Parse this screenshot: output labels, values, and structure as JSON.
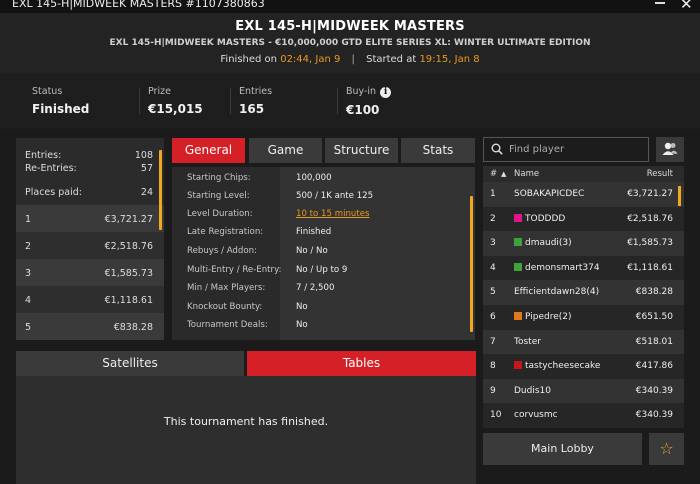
{
  "window": {
    "title": "EXL 145-H|MIDWEEK MASTERS #1107380863",
    "close_glyph": "✕"
  },
  "header": {
    "title": "EXL 145-H|MIDWEEK MASTERS",
    "subtitle": "EXL 145-H|MIDWEEK MASTERS - €10,000,000 GTD ELITE SERIES XL: WINTER ULTIMATE EDITION",
    "finished_label": "Finished on",
    "finished_time": "02:44, Jan 9",
    "separator": "|",
    "started_label": "Started at",
    "started_time": "19:15, Jan 8"
  },
  "summary": {
    "status_label": "Status",
    "status_value": "Finished",
    "prize_label": "Prize",
    "prize_value": "€15,015",
    "entries_label": "Entries",
    "entries_value": "165",
    "buyin_label": "Buy-in",
    "buyin_value": "€100",
    "info_icon": "info-icon"
  },
  "entries_box": {
    "entries_label": "Entries:",
    "entries_value": "108",
    "reentries_label": "Re-Entries:",
    "reentries_value": "57",
    "places_label": "Places paid:",
    "places_value": "24"
  },
  "payouts": [
    {
      "place": "1",
      "amount": "€3,721.27"
    },
    {
      "place": "2",
      "amount": "€2,518.76"
    },
    {
      "place": "3",
      "amount": "€1,585.73"
    },
    {
      "place": "4",
      "amount": "€1,118.61"
    },
    {
      "place": "5",
      "amount": "€838.28"
    }
  ],
  "tabs": {
    "general": "General",
    "game": "Game",
    "structure": "Structure",
    "stats": "Stats",
    "active": "general"
  },
  "details": [
    {
      "key": "Starting Chips:",
      "value": "100,000"
    },
    {
      "key": "Starting Level:",
      "value": "500 / 1K ante 125"
    },
    {
      "key": "Level Duration:",
      "value": "10 to 15 minutes"
    },
    {
      "key": "Late Registration:",
      "value": "Finished"
    },
    {
      "key": "Rebuys / Addon:",
      "value": "No / No"
    },
    {
      "key": "Multi-Entry / Re-Entry:",
      "value": "No / Up to 9"
    },
    {
      "key": "Min / Max Players:",
      "value": "7 / 2,500"
    },
    {
      "key": "Knockout Bounty:",
      "value": "No"
    },
    {
      "key": "Tournament Deals:",
      "value": "No"
    }
  ],
  "bottom_tabs": {
    "satellites": "Satellites",
    "tables": "Tables",
    "active": "tables"
  },
  "tables_message": "This tournament has finished.",
  "search": {
    "placeholder": "Find player"
  },
  "player_list": {
    "col_rank": "#",
    "col_sort": "▲",
    "col_name": "Name",
    "col_result": "Result",
    "rows": [
      {
        "rank": "1",
        "name": "SOBAKAPICDEC",
        "flag": "",
        "result": "€3,721.27"
      },
      {
        "rank": "2",
        "name": "TODDDD",
        "flag": "#e0158a",
        "result": "€2,518.76"
      },
      {
        "rank": "3",
        "name": "dmaudi(3)",
        "flag": "#3fa33a",
        "result": "€1,585.73"
      },
      {
        "rank": "4",
        "name": "demonsmart374",
        "flag": "#3fa33a",
        "result": "€1,118.61"
      },
      {
        "rank": "5",
        "name": "Efficientdawn28(4)",
        "flag": "",
        "result": "€838.28"
      },
      {
        "rank": "6",
        "name": "Pipedre(2)",
        "flag": "#e07a1e",
        "result": "€651.50"
      },
      {
        "rank": "7",
        "name": "Toster",
        "flag": "",
        "result": "€518.01"
      },
      {
        "rank": "8",
        "name": "tastycheesecake",
        "flag": "#c4161c",
        "result": "€417.86"
      },
      {
        "rank": "9",
        "name": "Dudis10",
        "flag": "",
        "result": "€340.39"
      },
      {
        "rank": "10",
        "name": "corvusmc",
        "flag": "",
        "result": "€340.39"
      }
    ]
  },
  "main_lobby": "Main Lobby",
  "colors": {
    "accent_red": "#d42026",
    "accent_orange": "#e89a1e"
  }
}
